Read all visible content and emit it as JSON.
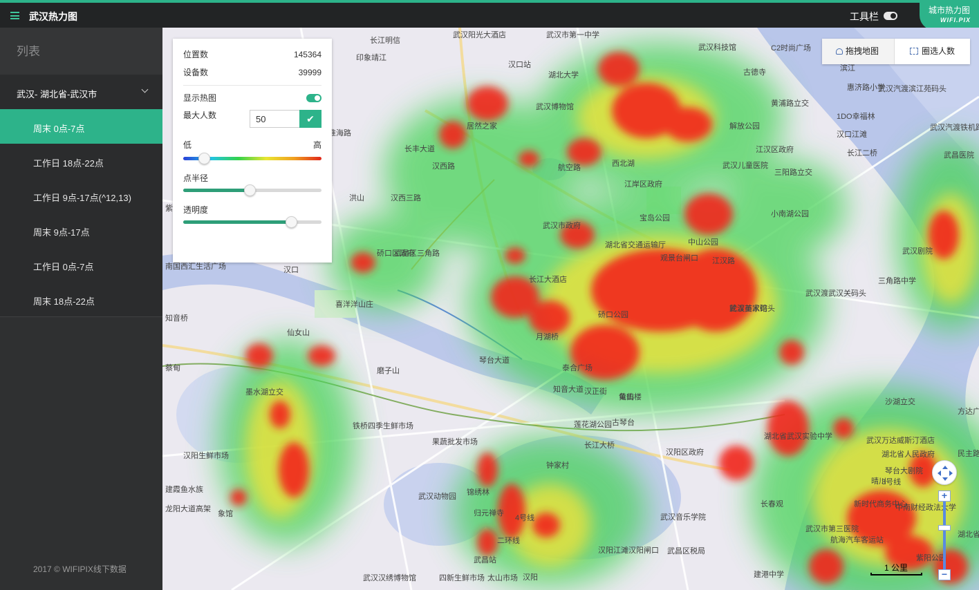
{
  "header": {
    "title": "武汉热力图",
    "toolbar_label": "工具栏",
    "brand_top": "城市热力图",
    "brand_bottom": "WIFI.PIX"
  },
  "sidebar": {
    "heading": "列表",
    "group_label": "武汉- 湖北省-武汉市",
    "items": [
      {
        "label": "周末 0点-7点",
        "active": true
      },
      {
        "label": "工作日 18点-22点",
        "active": false
      },
      {
        "label": "工作日 9点-17点(^12,13)",
        "active": false
      },
      {
        "label": "周末 9点-17点",
        "active": false
      },
      {
        "label": "工作日 0点-7点",
        "active": false
      },
      {
        "label": "周末 18点-22点",
        "active": false
      }
    ],
    "footer": "2017 © WIFIPIX线下数据"
  },
  "panel": {
    "positions_label": "位置数",
    "positions_value": "145364",
    "devices_label": "设备数",
    "devices_value": "39999",
    "show_heatmap_label": "显示热图",
    "show_heatmap": true,
    "max_people_label": "最大人数",
    "max_people_value": "50",
    "low_label": "低",
    "high_label": "高",
    "color_range_level": 0.15,
    "radius_label": "点半径",
    "radius_level": 0.48,
    "opacity_label": "透明度",
    "opacity_level": 0.78
  },
  "map_controls": {
    "drag_map_label": "拖拽地图",
    "select_people_label": "圈选人数",
    "scale_label": "1 公里",
    "zoom_in": "+",
    "zoom_out": "−"
  },
  "map_labels": [
    "武汉阳光大酒店",
    "武汉市第一中学",
    "长江明信",
    "印象靖江",
    "汉口站",
    "武汉科技馆",
    "C2时尚广场",
    "古德寺",
    "滨江",
    "惠济路小学",
    "武汉汽渡滨江苑码头",
    "黄浦路立交",
    "1DO幸福林",
    "武汉汽渡铁机路码头",
    "解放公园",
    "汉口江滩",
    "长江二桥",
    "武昌医院",
    "武汉博物馆",
    "居然之家",
    "航空路",
    "西北湖",
    "江汉区政府",
    "武汉儿童医院",
    "三阳路立交",
    "江岸区政府",
    "宝岛公园",
    "小南湖公园",
    "武汉市政府",
    "湖北省交通运输厅",
    "中山公园",
    "武汉剧院",
    "观景台闸口",
    "江汉路",
    "武汉美术馆",
    "长江大酒店",
    "轮渡苗家码头",
    "武汉渡武汉关码头",
    "三角路中学",
    "武昌区三角路",
    "汉口",
    "硚口区政府",
    "南国西汇生活广场",
    "喜洋洋山庄",
    "知音桥",
    "仙女山",
    "琴台大道",
    "月湖桥",
    "硚口公园",
    "泰合广场",
    "汉正街",
    "黄鹤楼",
    "沙湖立交",
    "湖北省武汉实验中学",
    "武汉万达威斯汀酒店",
    "方达广场",
    "湖北省人民政府",
    "民主路",
    "晴川",
    "琴台大剧院",
    "知音大道",
    "龟山",
    "古琴台",
    "莲花湖公园",
    "长江大桥",
    "汉阳区政府",
    "铁桥四季生鲜市场",
    "磨子山",
    "墨水湖立交",
    "果蔬批发市场",
    "汉阳生鲜市场",
    "建霞鱼水族",
    "龙阳大道高架",
    "象馆",
    "武汉动物园",
    "锦绣林",
    "归元禅寺",
    "钟家村",
    "汉阳江滩汉阳闸口",
    "武汉音乐学院",
    "武昌区税局",
    "紫阳公园",
    "武昌站",
    "武汉汉绣博物馆",
    "四新生鲜市场",
    "太山市场",
    "建港中学",
    "航海汽车客运站",
    "新时代商务中心",
    "长春观",
    "武汉市第三医院",
    "中南财经政法大学",
    "湖北省图书馆",
    "洪山",
    "汉西三路",
    "汉西路",
    "淮海路",
    "长丰大道",
    "紫阳路",
    "蔡甸",
    "4号线",
    "3号线",
    "二环线",
    "汉阳",
    "湖北大学"
  ]
}
